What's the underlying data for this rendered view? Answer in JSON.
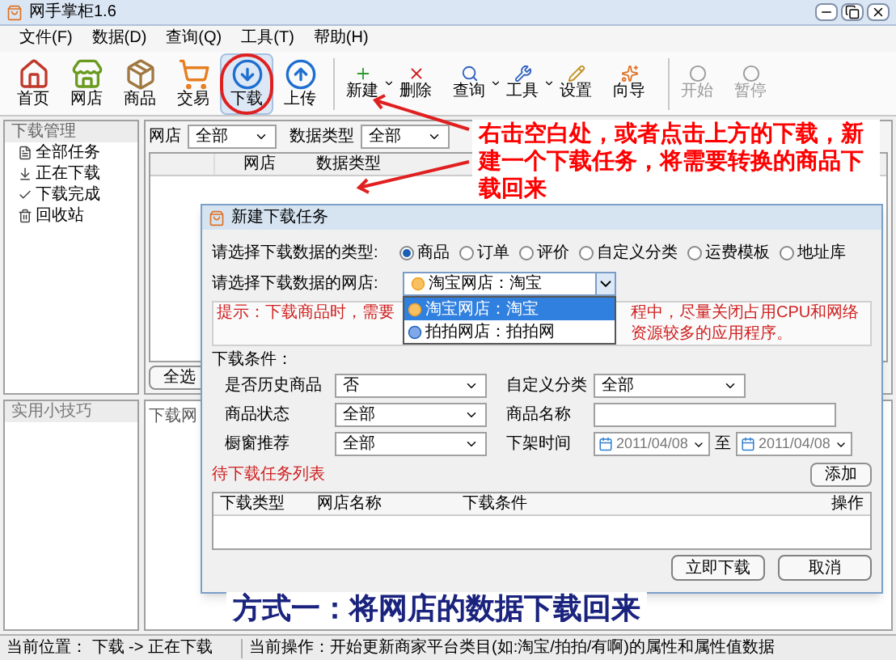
{
  "window": {
    "title": "网手掌柜1.6"
  },
  "menu": [
    "文件(F)",
    "数据(D)",
    "查询(Q)",
    "工具(T)",
    "帮助(H)"
  ],
  "toolbar": [
    {
      "label": "首页",
      "kind": "big",
      "selected": false,
      "circled": false
    },
    {
      "label": "网店",
      "kind": "big",
      "selected": false,
      "circled": false
    },
    {
      "label": "商品",
      "kind": "big",
      "selected": false,
      "circled": false
    },
    {
      "label": "交易",
      "kind": "big",
      "selected": false,
      "circled": false
    },
    {
      "label": "下载",
      "kind": "big",
      "selected": true,
      "circled": true
    },
    {
      "label": "上传",
      "kind": "big",
      "selected": false,
      "circled": false
    },
    {
      "kind": "separator"
    },
    {
      "label": "新建",
      "kind": "small",
      "dropdown": true,
      "disabled": false
    },
    {
      "label": "删除",
      "kind": "small",
      "dropdown": false,
      "disabled": false
    },
    {
      "label": "查询",
      "kind": "small",
      "dropdown": true,
      "disabled": false
    },
    {
      "label": "工具",
      "kind": "small",
      "dropdown": true,
      "disabled": false
    },
    {
      "label": "设置",
      "kind": "small",
      "dropdown": false,
      "disabled": false
    },
    {
      "label": "向导",
      "kind": "small",
      "dropdown": false,
      "disabled": false
    },
    {
      "kind": "separator"
    },
    {
      "label": "开始",
      "kind": "small",
      "dropdown": false,
      "disabled": true
    },
    {
      "label": "暂停",
      "kind": "small",
      "dropdown": false,
      "disabled": true
    }
  ],
  "sidebar": {
    "title": "下载管理",
    "items": [
      {
        "label": "全部任务"
      },
      {
        "label": "正在下载"
      },
      {
        "label": "下载完成"
      },
      {
        "label": "回收站"
      }
    ]
  },
  "tips_panel": {
    "title": "实用小技巧"
  },
  "filters": [
    {
      "label": "网店",
      "value": "全部"
    },
    {
      "label": "数据类型",
      "value": "全部"
    }
  ],
  "task_table": {
    "columns": [
      "网店",
      "数据类型"
    ]
  },
  "select_all_button": "全选",
  "lower_pane": {
    "column_1": "下载网"
  },
  "dialog": {
    "title": "新建下载任务",
    "type_label": "请选择下载数据的类型:",
    "types": [
      {
        "label": "商品",
        "selected": true
      },
      {
        "label": "订单",
        "selected": false
      },
      {
        "label": "评价",
        "selected": false
      },
      {
        "label": "自定义分类",
        "selected": false
      },
      {
        "label": "运费模板",
        "selected": false
      },
      {
        "label": "地址库",
        "selected": false
      }
    ],
    "shop_label": "请选择下载数据的网店:",
    "shop_value": "淘宝网店：淘宝",
    "shop_options": [
      {
        "label": "淘宝网店：淘宝",
        "selected": true,
        "kind": "taobao"
      },
      {
        "label": "拍拍网店：拍拍网",
        "selected": false,
        "kind": "paipai"
      }
    ],
    "hint_parts": [
      "提示：下载商品时，需要",
      "程中，尽量关闭占用CPU和网络资源较多的应用程序。"
    ],
    "conditions_title": "下载条件：",
    "conditions": [
      {
        "label": "是否历史商品",
        "kind": "select",
        "value": "否"
      },
      {
        "label": "自定义分类",
        "kind": "select",
        "value": "全部"
      },
      {
        "label": "商品状态",
        "kind": "select",
        "value": "全部"
      },
      {
        "label": "商品名称",
        "kind": "text"
      },
      {
        "label": "橱窗推荐",
        "kind": "select",
        "value": "全部"
      },
      {
        "label": "下架时间",
        "kind": "daterange",
        "from": "2011/04/08",
        "separator": "至",
        "to": "2011/04/08"
      }
    ],
    "list_title": "待下载任务列表",
    "add_button": "添加",
    "columns": [
      "下载类型",
      "网店名称",
      "下载条件",
      "操作"
    ],
    "buttons": [
      "立即下载",
      "取消"
    ]
  },
  "annotation": {
    "text": "右击空白处，或者点击上方的下载，新建一个下载任务，将需要转换的商品下载回来"
  },
  "caption": "方式一：将网店的数据下载回来",
  "status_bar": {
    "location": "当前位置： 下载 -> 正在下载",
    "operation": "当前操作：开始更新商家平台类目(如:淘宝/拍拍/有啊)的属性和属性值数据"
  }
}
